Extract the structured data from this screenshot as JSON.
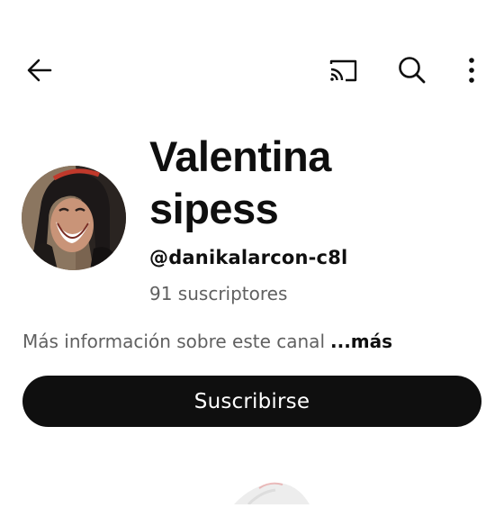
{
  "topbar": {
    "back_icon": "arrow-left-icon",
    "cast_icon": "cast-icon",
    "search_icon": "search-icon",
    "more_icon": "more-vert-icon"
  },
  "channel": {
    "name_line1": "Valentina",
    "name_line2": "sipess",
    "handle": "@danikalarcon-c8l",
    "subscribers": "91 suscriptores",
    "description": "Más información sobre este canal",
    "more_label": "...más",
    "subscribe_label": "Suscribirse"
  },
  "colors": {
    "text_primary": "#0f0f0f",
    "text_secondary": "#606060",
    "button_bg": "#0f0f0f",
    "button_text": "#ffffff"
  }
}
